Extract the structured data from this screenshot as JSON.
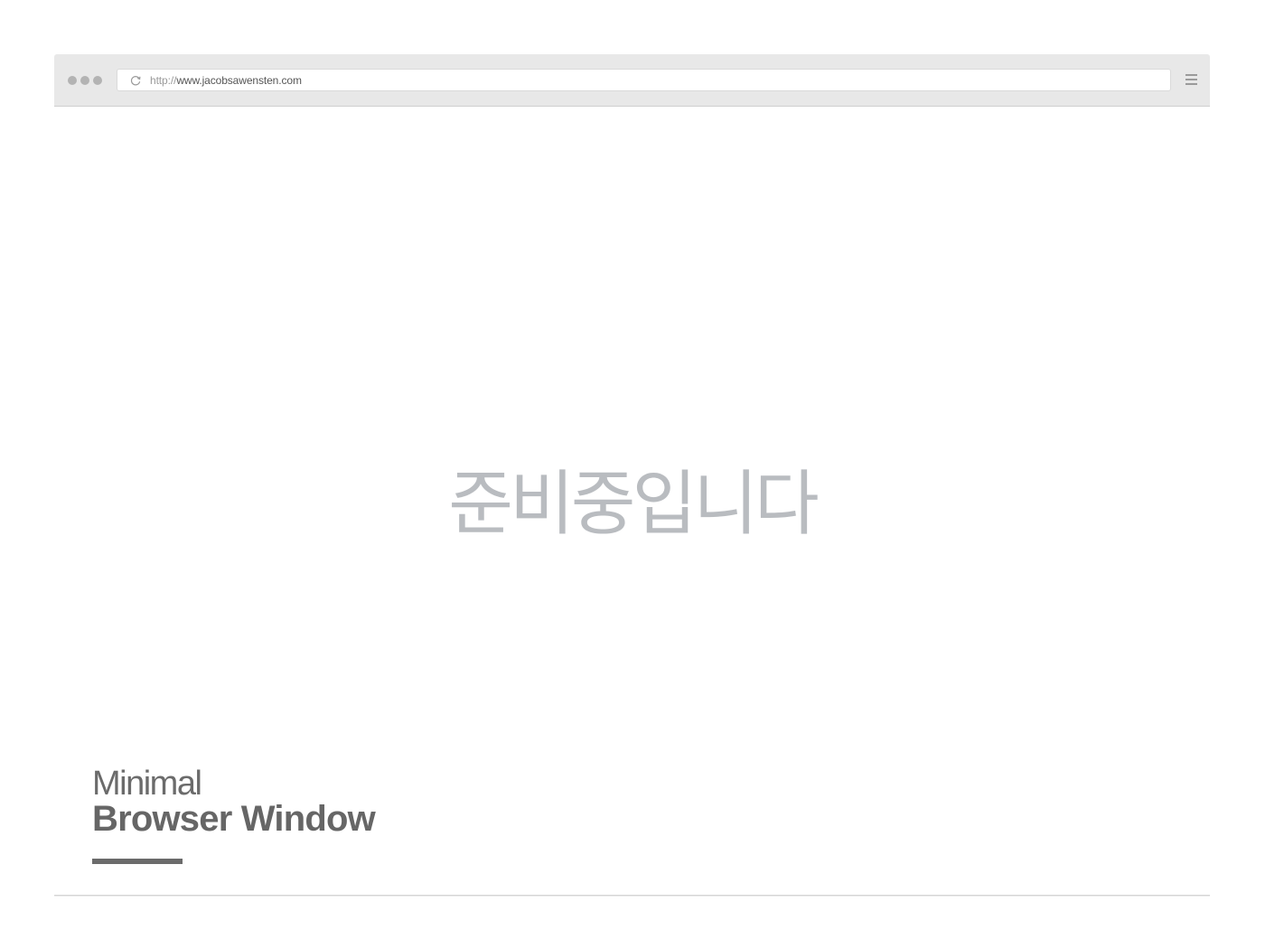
{
  "browser": {
    "url_scheme": "http://",
    "url_host": "www.jacobsawensten.com",
    "window_controls": [
      "dot",
      "dot",
      "dot"
    ],
    "reload_icon": "reload-icon",
    "menu_icon": "hamburger-menu-icon"
  },
  "page": {
    "heading": "준비중입니다"
  },
  "caption": {
    "line1": "Minimal",
    "line2": "Browser Window"
  },
  "colors": {
    "toolbar_bg": "#e8e8e8",
    "heading_color": "#b9bcc0",
    "caption_color": "#666666"
  }
}
